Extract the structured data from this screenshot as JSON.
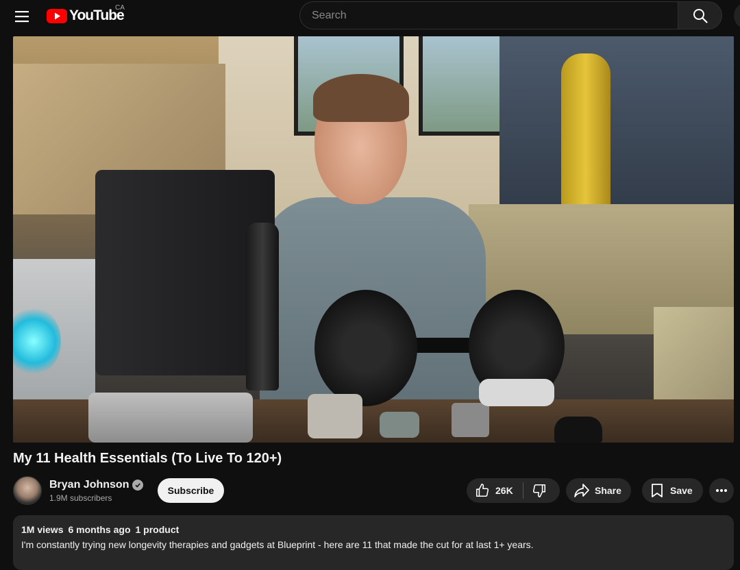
{
  "header": {
    "logo_text": "YouTube",
    "country_code": "CA",
    "search_placeholder": "Search"
  },
  "video": {
    "title": "My 11 Health Essentials (To Live To 120+)"
  },
  "channel": {
    "name": "Bryan Johnson",
    "subscribers": "1.9M subscribers",
    "subscribe_label": "Subscribe"
  },
  "actions": {
    "likes": "26K",
    "share_label": "Share",
    "save_label": "Save"
  },
  "description": {
    "views": "1M views",
    "age": "6 months ago",
    "products": "1 product",
    "text": "I'm constantly trying new longevity therapies and gadgets at Blueprint - here are 11 that made the cut for at last 1+ years."
  },
  "colors": {
    "background": "#0f0f0f",
    "brand_red": "#ff0000",
    "pill_bg": "#272727",
    "subscribe_bg": "#f1f1f1"
  }
}
